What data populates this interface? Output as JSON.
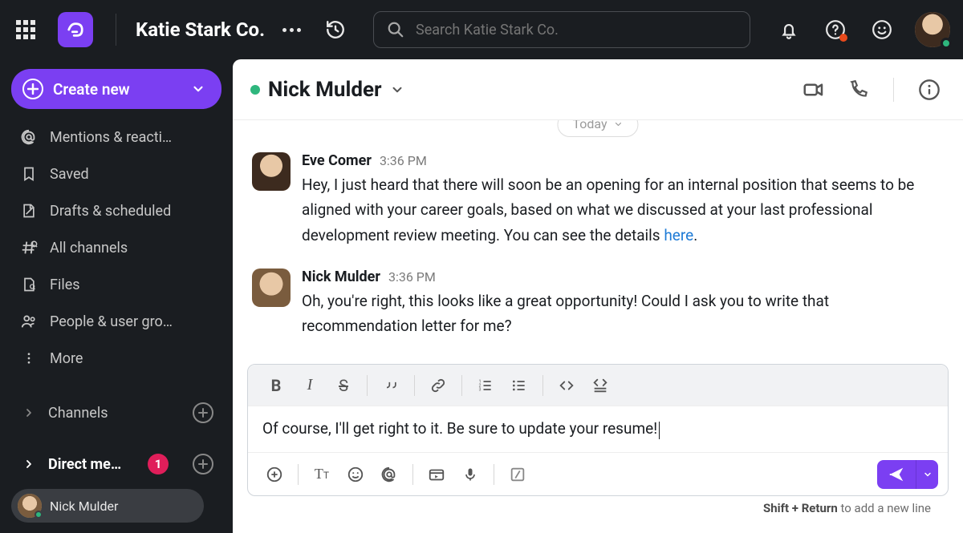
{
  "colors": {
    "accent": "#7b3ff2",
    "presence_online": "#2eb67d",
    "danger": "#e01e5a"
  },
  "workspace_name": "Katie Stark Co.",
  "search_placeholder": "Search Katie Stark Co.",
  "sidebar": {
    "create_label": "Create new",
    "items": [
      {
        "label": "Mentions & reacti…",
        "icon": "at"
      },
      {
        "label": "Saved",
        "icon": "bookmark"
      },
      {
        "label": "Drafts & scheduled",
        "icon": "draft"
      },
      {
        "label": "All channels",
        "icon": "all-channels"
      },
      {
        "label": "Files",
        "icon": "files"
      },
      {
        "label": "People & user gro…",
        "icon": "people"
      },
      {
        "label": "More",
        "icon": "more"
      }
    ],
    "sections": [
      {
        "label": "Channels",
        "badge": null
      },
      {
        "label": "Direct me…",
        "badge": "1"
      }
    ],
    "dm_active": {
      "name": "Nick Mulder"
    }
  },
  "chat": {
    "header_name": "Nick Mulder",
    "date_separator": "Today",
    "messages": [
      {
        "author": "Eve Comer",
        "time": "3:36 PM",
        "body_plain": "Hey, I just heard that there will soon be an opening for an internal position that seems to be aligned with your career goals, based on what we discussed at your last professional development review meeting. You can see the details ",
        "link_text": "here",
        "body_after_link": "."
      },
      {
        "author": "Nick Mulder",
        "time": "3:36 PM",
        "body_plain": "Oh, you're right, this looks like a great opportunity! Could I ask you to write that recommendation letter for me?",
        "link_text": "",
        "body_after_link": ""
      }
    ],
    "composer_value": "Of course, I'll get right to it. Be sure to update your resume!",
    "hint_keys": "Shift + Return",
    "hint_rest": " to add a new line"
  }
}
